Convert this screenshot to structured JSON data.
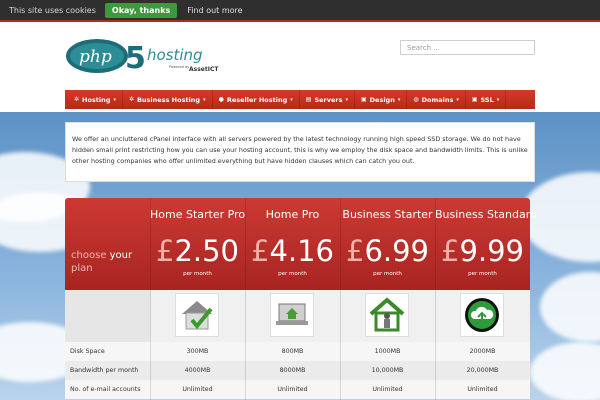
{
  "cookie_bar": {
    "text": "This site uses cookies",
    "ok_label": "Okay, thanks",
    "more_label": "Find out more"
  },
  "logo": {
    "php": "php",
    "five": "5",
    "hosting": "hosting",
    "powered": "Powered by",
    "brand": "AssetICT"
  },
  "search": {
    "placeholder": "Search ..."
  },
  "nav": [
    {
      "label": "Hosting",
      "icon": "gear-icon",
      "glyph": "✲"
    },
    {
      "label": "Business Hosting",
      "icon": "gears-icon",
      "glyph": "✲"
    },
    {
      "label": "Reseller Hosting",
      "icon": "users-icon",
      "glyph": "●"
    },
    {
      "label": "Servers",
      "icon": "server-icon",
      "glyph": "▤"
    },
    {
      "label": "Design",
      "icon": "image-icon",
      "glyph": "▣"
    },
    {
      "label": "Domains",
      "icon": "globe-icon",
      "glyph": "◍"
    },
    {
      "label": "SSL",
      "icon": "lock-icon",
      "glyph": "▣"
    }
  ],
  "intro_text": "We offer an uncluttered cPanel interface with all servers powered by the latest technology running high speed SSD storage. We do not have hidden small print restricting how you can use your hosting account, this is why we employ the disk space and bandwidth limits. This is unlike other hosting companies who offer unlimited everything but have hidden clauses which can catch you out.",
  "pricing": {
    "choose_prefix": "choose",
    "choose_your": "your",
    "choose_plan": "plan",
    "currency": "£",
    "per_label": "per month",
    "plans": [
      {
        "name": "Home Starter Pro",
        "price": "2.50",
        "icon": "house-check-icon"
      },
      {
        "name": "Home Pro",
        "price": "4.16",
        "icon": "laptop-house-icon"
      },
      {
        "name": "Business Starter",
        "price": "6.99",
        "icon": "house-person-icon"
      },
      {
        "name": "Business Standard",
        "price": "9.99",
        "icon": "cloud-upload-icon"
      }
    ],
    "rows": [
      {
        "label": "Disk Space",
        "values": [
          "300MB",
          "800MB",
          "1000MB",
          "2000MB"
        ]
      },
      {
        "label": "Bandwidth per month",
        "values": [
          "4000MB",
          "8000MB",
          "10,000MB",
          "20,000MB"
        ]
      },
      {
        "label": "No. of e-mail accounts",
        "values": [
          "Unlimited",
          "Unlimited",
          "Unlimited",
          "Unlimited"
        ]
      }
    ]
  },
  "colors": {
    "brand_red": "#b52a1b",
    "ok_green": "#3c9a3c",
    "logo_teal": "#1d6d78"
  }
}
